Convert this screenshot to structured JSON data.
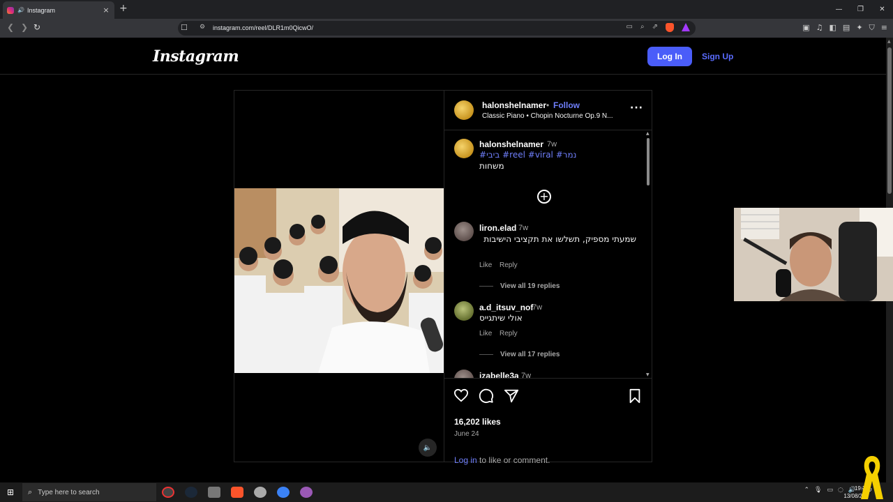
{
  "browser": {
    "tab_title": "Instagram",
    "url": "instagram.com/reel/DLR1m0QicwO/"
  },
  "header": {
    "logo": "Instagram",
    "login_label": "Log In",
    "signup_label": "Sign Up"
  },
  "post": {
    "username": "halonshelnamer",
    "follow_label": "Follow",
    "audio": "Classic Piano • Chopin Nocturne Op.9 N...",
    "caption": {
      "username": "halonshelnamer",
      "time": "7w",
      "tags": "#ביבי #reel #viral #נמר",
      "text": "משחות"
    },
    "comments": [
      {
        "username": "liron.elad",
        "time": "7w",
        "text": "שמעתי מספיק, תשלשו את תקציבי הישיבות",
        "like": "Like",
        "reply": "Reply",
        "replies": "View all 19 replies"
      },
      {
        "username": "a.d_itsuv_nof",
        "time": "7w",
        "text": "אולי שיתגייס",
        "like": "Like",
        "reply": "Reply",
        "replies": "View all 17 replies"
      },
      {
        "username": "izabelle3a",
        "time": "7w"
      }
    ],
    "likes": "16,202 likes",
    "date": "June 24",
    "login_link": "Log in",
    "login_rest": " to like or comment."
  },
  "taskbar": {
    "search_placeholder": "Type here to search",
    "language": "עבר",
    "time": "19:28",
    "date": "13/08/202"
  }
}
